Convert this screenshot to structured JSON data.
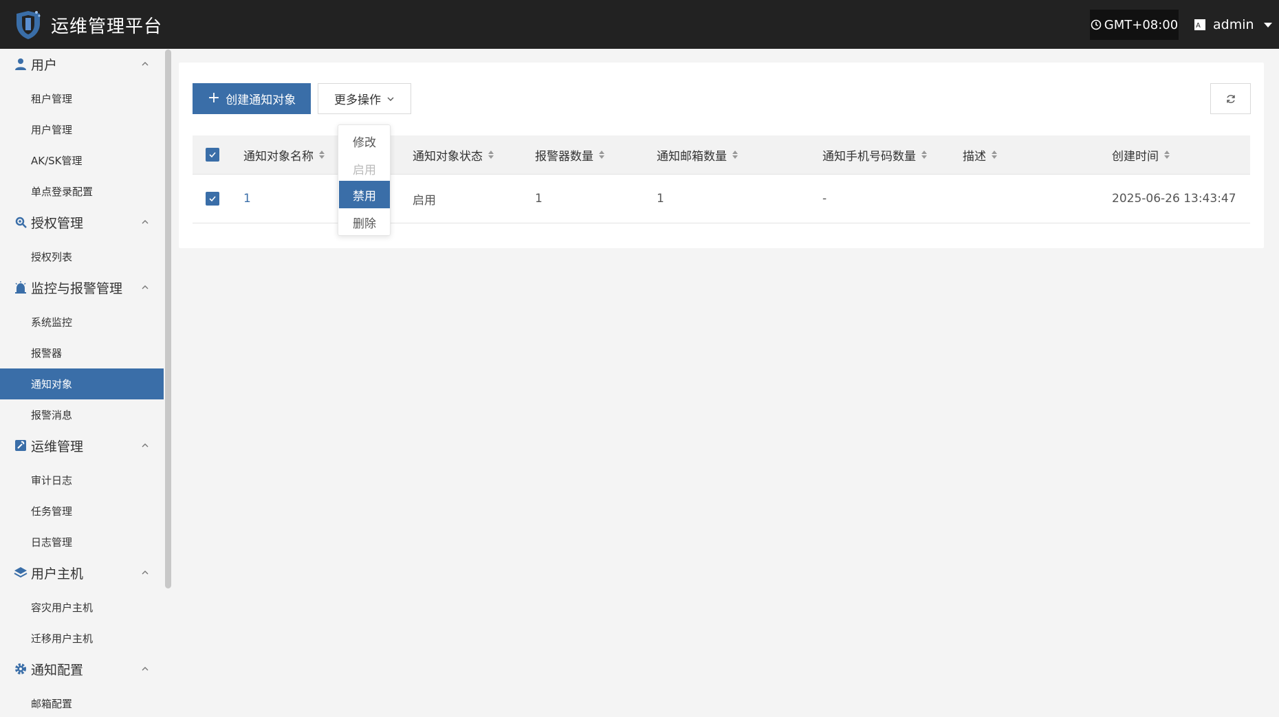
{
  "header": {
    "app_title": "运维管理平台",
    "timezone": "GMT+08:00",
    "username": "admin"
  },
  "sidebar": {
    "groups": [
      {
        "label": "用户",
        "icon": "user-icon",
        "items": [
          "租户管理",
          "用户管理",
          "AK/SK管理",
          "单点登录配置"
        ]
      },
      {
        "label": "授权管理",
        "icon": "key-gear-icon",
        "items": [
          "授权列表"
        ]
      },
      {
        "label": "监控与报警管理",
        "icon": "alarm-icon",
        "items": [
          "系统监控",
          "报警器",
          "通知对象",
          "报警消息"
        ]
      },
      {
        "label": "运维管理",
        "icon": "wrench-icon",
        "items": [
          "审计日志",
          "任务管理",
          "日志管理"
        ]
      },
      {
        "label": "用户主机",
        "icon": "layers-icon",
        "items": [
          "容灾用户主机",
          "迁移用户主机"
        ]
      },
      {
        "label": "通知配置",
        "icon": "gear-icon",
        "items": [
          "邮箱配置"
        ]
      }
    ],
    "active_item": "通知对象"
  },
  "toolbar": {
    "create_label": "创建通知对象",
    "more_label": "更多操作"
  },
  "dropdown": {
    "items": [
      "修改",
      "启用",
      "禁用",
      "删除"
    ],
    "disabled": "启用",
    "highlighted": "禁用"
  },
  "table": {
    "columns": [
      "通知对象名称",
      "通知对象状态",
      "报警器数量",
      "通知邮箱数量",
      "通知手机号码数量",
      "描述",
      "创建时间"
    ],
    "rows": [
      {
        "name": "1",
        "status": "启用",
        "alarm_count": "1",
        "email_count": "1",
        "phone_count": "-",
        "description": "",
        "created": "2025-06-26 13:43:47"
      }
    ]
  },
  "colors": {
    "accent": "#3a6ea8",
    "header_bg": "#222222",
    "page_bg": "#f4f4f4"
  }
}
